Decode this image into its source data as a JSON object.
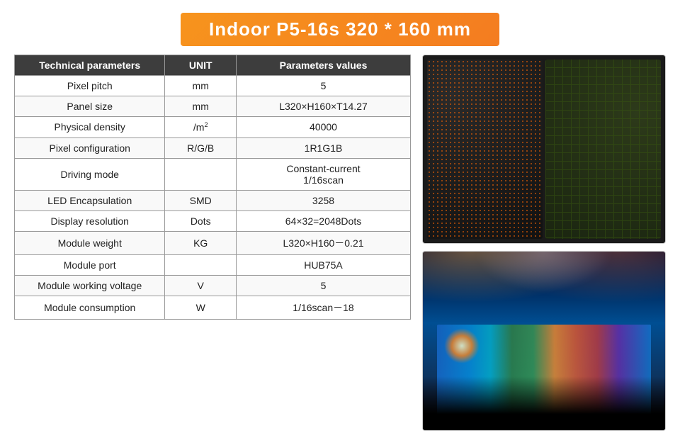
{
  "title": "Indoor P5-16s  320 * 160 mm",
  "table": {
    "headers": [
      "Technical parameters",
      "UNIT",
      "Parameters values"
    ],
    "rows": [
      {
        "param": "Pixel pitch",
        "unit": "mm",
        "value": "5"
      },
      {
        "param": "Panel size",
        "unit": "mm",
        "value": "L320×H160×T14.27"
      },
      {
        "param": "Physical density",
        "unit": "/m²",
        "value": "40000"
      },
      {
        "param": "Pixel configuration",
        "unit": "R/G/B",
        "value": "1R1G1B"
      },
      {
        "param": "Driving mode",
        "unit": "",
        "value": "Constant-current\n1/16scan"
      },
      {
        "param": "LED Encapsulation",
        "unit": "SMD",
        "value": "3258"
      },
      {
        "param": "Display resolution",
        "unit": "Dots",
        "value": "64×32=2048Dots"
      },
      {
        "param": "Module weight",
        "unit": "KG",
        "value": "L320×H160－0.21"
      },
      {
        "param": "Module port",
        "unit": "",
        "value": "HUB75A"
      },
      {
        "param": "Module working voltage",
        "unit": "V",
        "value": "5"
      },
      {
        "param": "Module consumption",
        "unit": "W",
        "value": "1/16scan－18"
      }
    ]
  },
  "images": {
    "top_alt": "LED panel front and back",
    "bottom_alt": "LED display screen in use"
  }
}
